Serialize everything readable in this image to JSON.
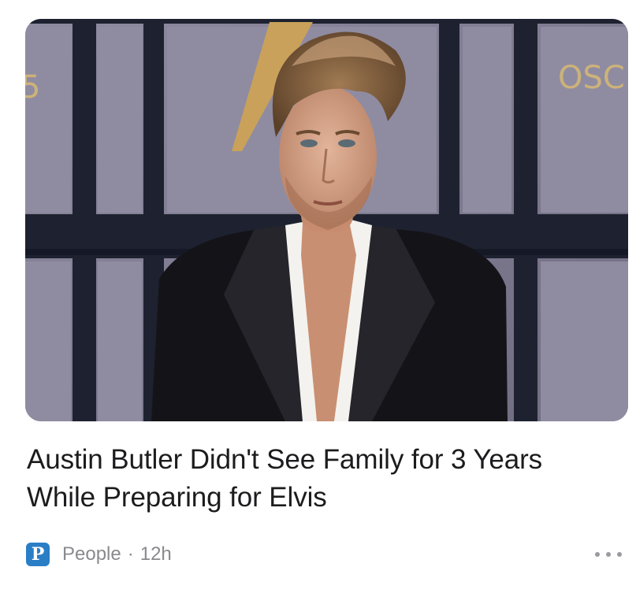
{
  "article": {
    "image_alt": "Austin Butler on a red carpet",
    "backdrop_text": "OSC",
    "backdrop_left_text": "5",
    "headline": "Austin Butler Didn't See Family for 3 Years While Preparing for Elvis"
  },
  "source": {
    "logo_letter": "P",
    "publication": "People",
    "separator": "·",
    "age": "12h",
    "logo_color": "#2a7ec6"
  },
  "more": {
    "icon": "ellipsis-icon"
  }
}
